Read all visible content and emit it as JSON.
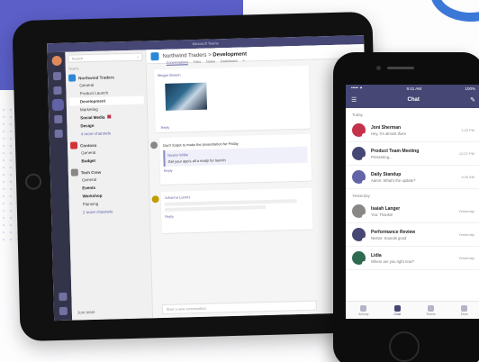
{
  "tablet": {
    "window_title": "Microsoft Teams",
    "search_placeholder": "Search",
    "list_section_label": "Teams",
    "teams": [
      {
        "name": "Northwind Traders",
        "logo_color": "#2b88d8",
        "channels": [
          {
            "label": "General",
            "style": "normal"
          },
          {
            "label": "Product Launch",
            "style": "normal"
          },
          {
            "label": "Development",
            "style": "active"
          },
          {
            "label": "Marketing",
            "style": "normal"
          },
          {
            "label": "Social Media",
            "style": "bold",
            "badge": true
          },
          {
            "label": "Design",
            "style": "bold"
          },
          {
            "label": "4 more channels",
            "style": "link"
          }
        ]
      },
      {
        "name": "Contoso",
        "logo_color": "#d13438",
        "channels": [
          {
            "label": "General",
            "style": "normal"
          },
          {
            "label": "Budget",
            "style": "bold"
          }
        ]
      },
      {
        "name": "Tech Crew",
        "logo_color": "#8a8886",
        "channels": [
          {
            "label": "General",
            "style": "normal"
          },
          {
            "label": "Events",
            "style": "bold"
          },
          {
            "label": "Workshop",
            "style": "bold"
          },
          {
            "label": "Planning",
            "style": "normal"
          },
          {
            "label": "2 more channels",
            "style": "link"
          }
        ]
      }
    ],
    "join_label": "Join team",
    "header": {
      "team": "Northwind Traders",
      "sep": ">",
      "channel": "Development"
    },
    "tabs": [
      "Conversations",
      "Files",
      "Notes",
      "Dashboard",
      "+"
    ],
    "posts": [
      {
        "author": "Megan Bowen",
        "text": "",
        "reply": "Reply"
      },
      {
        "author": "",
        "text": "Don't forget to make the presentation for Friday",
        "reply": "Reply"
      },
      {
        "author": "Nestor Wilke",
        "text": "Get your app's all a ready for launch",
        "reply": "Reply"
      },
      {
        "author": "Johanna Lorenz",
        "text": "",
        "reply": "Reply"
      }
    ],
    "compose_placeholder": "Start a new conversation"
  },
  "phone": {
    "status": {
      "carrier": "••••• ✦",
      "time": "9:41 AM",
      "battery": "100%"
    },
    "header": {
      "left_icon": "menu-icon",
      "title": "Chat",
      "right_icon": "compose-icon"
    },
    "sections": [
      {
        "label": "Today",
        "items": [
          {
            "name": "Joni Sherman",
            "sub": "Hey, I'm almost there",
            "time": "1:25 PM",
            "color": "#c4314b"
          },
          {
            "name": "Product Team Meeting",
            "sub": "Presenting...",
            "time": "12:07 PM",
            "color": "#464775"
          },
          {
            "name": "Daily Standup",
            "sub": "Aaron: What's the update?",
            "time": "9:40 AM",
            "color": "#6264a7"
          }
        ]
      },
      {
        "label": "Yesterday",
        "items": [
          {
            "name": "Isaiah Langer",
            "sub": "You: Thanks!",
            "time": "Yesterday",
            "color": "#8a8886"
          },
          {
            "name": "Performance Review",
            "sub": "Nestor: Sounds good",
            "time": "Yesterday",
            "color": "#464775"
          },
          {
            "name": "Lidia",
            "sub": "Where are you right now?",
            "time": "Yesterday",
            "color": "#2d6a4f"
          }
        ]
      }
    ],
    "tabs": [
      {
        "label": "Activity",
        "active": false
      },
      {
        "label": "Chat",
        "active": true
      },
      {
        "label": "Teams",
        "active": false
      },
      {
        "label": "More",
        "active": false
      }
    ]
  }
}
